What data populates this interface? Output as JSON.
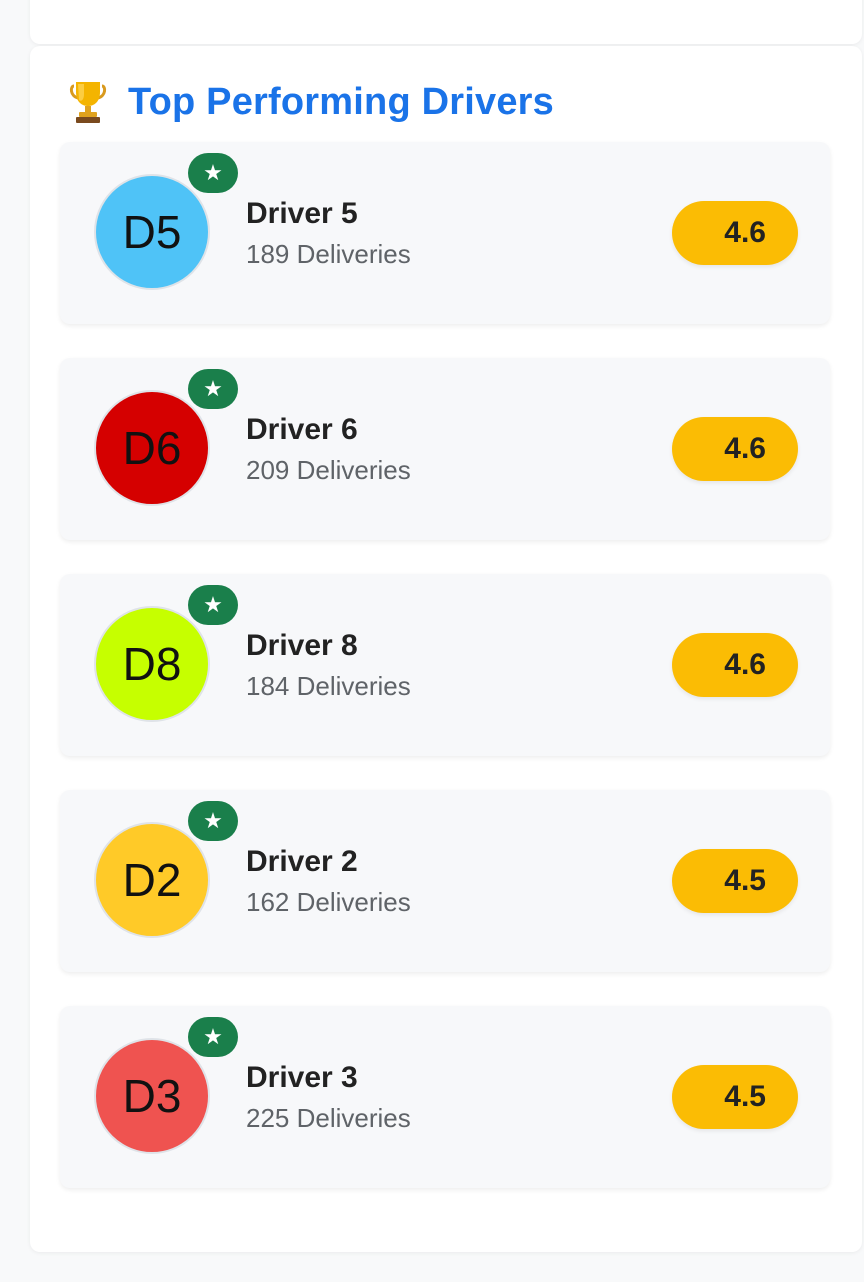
{
  "section": {
    "title": "Top Performing Drivers",
    "icon": "trophy-icon"
  },
  "drivers": [
    {
      "initials": "D5",
      "name": "Driver 5",
      "deliveries": "189 Deliveries",
      "rating": "4.6",
      "avatar_color": "#4fc3f7",
      "badge_icon": "star-icon",
      "badge_glyph": "★"
    },
    {
      "initials": "D6",
      "name": "Driver 6",
      "deliveries": "209 Deliveries",
      "rating": "4.6",
      "avatar_color": "#d50000",
      "badge_icon": "star-icon",
      "badge_glyph": "★"
    },
    {
      "initials": "D8",
      "name": "Driver 8",
      "deliveries": "184 Deliveries",
      "rating": "4.6",
      "avatar_color": "#c6ff00",
      "badge_icon": "star-icon",
      "badge_glyph": "★"
    },
    {
      "initials": "D2",
      "name": "Driver 2",
      "deliveries": "162 Deliveries",
      "rating": "4.5",
      "avatar_color": "#ffca28",
      "badge_icon": "star-icon",
      "badge_glyph": "★"
    },
    {
      "initials": "D3",
      "name": "Driver 3",
      "deliveries": "225 Deliveries",
      "rating": "4.5",
      "avatar_color": "#ef5350",
      "badge_icon": "star-icon",
      "badge_glyph": "★"
    }
  ],
  "colors": {
    "title": "#1a73e8",
    "badge": "#1a7f4b",
    "rating_pill": "#fbbc04"
  }
}
